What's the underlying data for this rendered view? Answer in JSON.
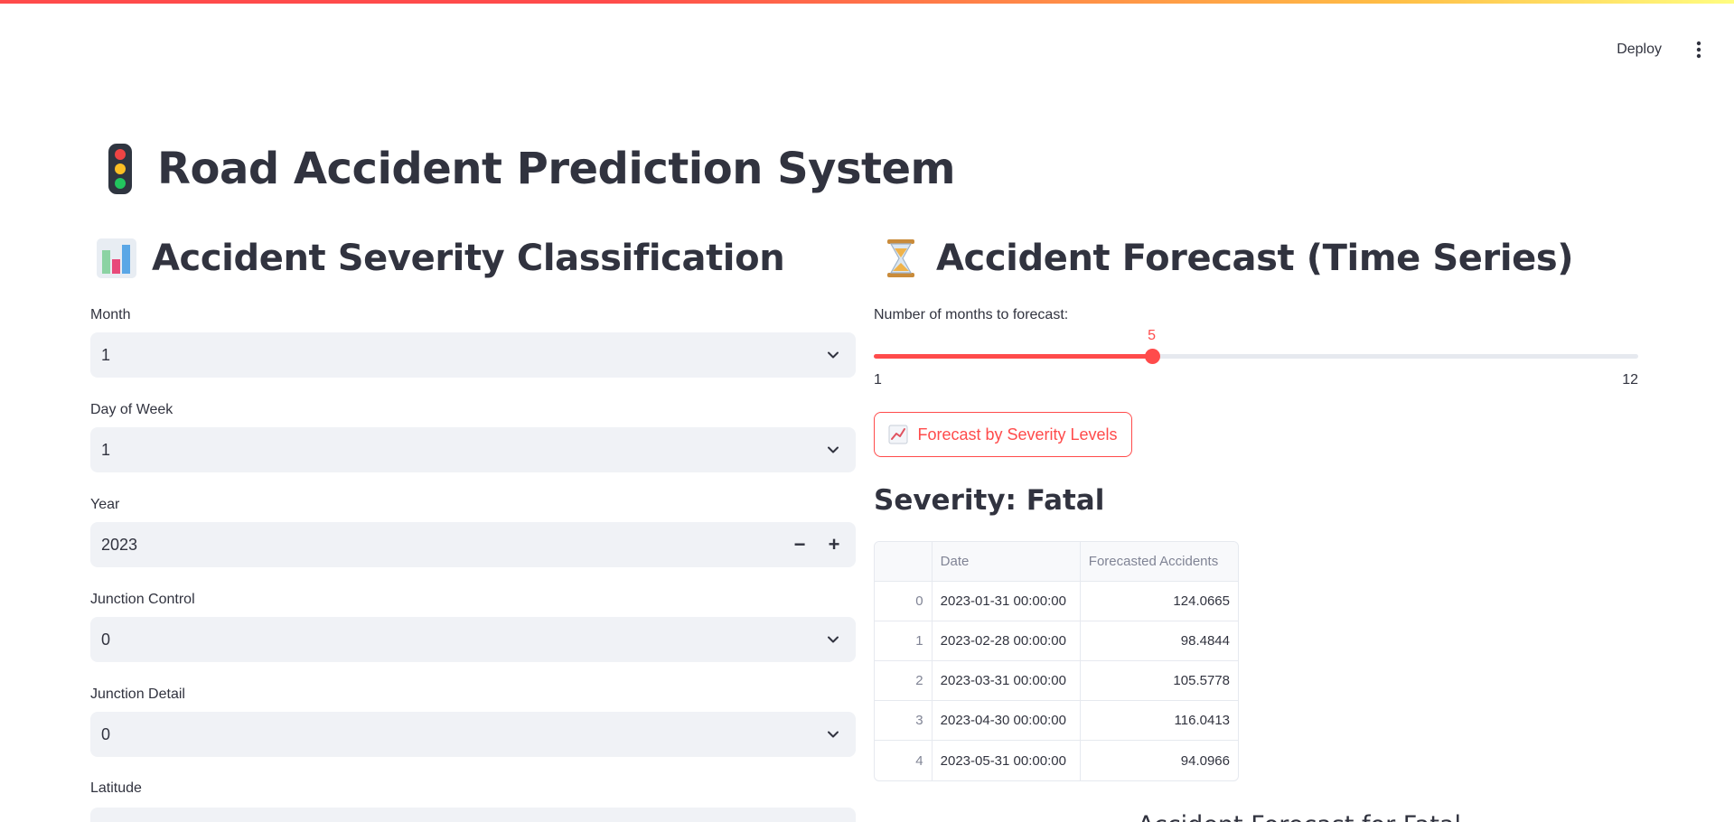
{
  "app": {
    "title": "Road Accident Prediction System",
    "deploy_label": "Deploy",
    "accent_color": "#ff4b4b"
  },
  "left": {
    "heading": "Accident Severity Classification",
    "heading_icon": "bar-chart-icon",
    "fields": {
      "month": {
        "label": "Month",
        "value": "1"
      },
      "day_of_week": {
        "label": "Day of Week",
        "value": "1"
      },
      "year": {
        "label": "Year",
        "value": "2023",
        "decrement": "−",
        "increment": "+"
      },
      "junction_control": {
        "label": "Junction Control",
        "value": "0"
      },
      "junction_detail": {
        "label": "Junction Detail",
        "value": "0"
      },
      "latitude": {
        "label": "Latitude"
      }
    }
  },
  "right": {
    "heading": "Accident Forecast (Time Series)",
    "heading_icon": "hourglass-icon",
    "slider": {
      "label": "Number of months to forecast:",
      "value": 5,
      "min": 1,
      "max": 12
    },
    "forecast_button_label": "Forecast by Severity Levels",
    "forecast_button_icon": "trend-chart-icon",
    "severity_heading": "Severity: Fatal",
    "table": {
      "columns": [
        "",
        "Date",
        "Forecasted Accidents"
      ],
      "rows": [
        [
          "0",
          "2023-01-31 00:00:00",
          "124.0665"
        ],
        [
          "1",
          "2023-02-28 00:00:00",
          "98.4844"
        ],
        [
          "2",
          "2023-03-31 00:00:00",
          "105.5778"
        ],
        [
          "3",
          "2023-04-30 00:00:00",
          "116.0413"
        ],
        [
          "4",
          "2023-05-31 00:00:00",
          "94.0966"
        ]
      ]
    },
    "chart_title_partial": "Accident Forecast for Fatal"
  }
}
